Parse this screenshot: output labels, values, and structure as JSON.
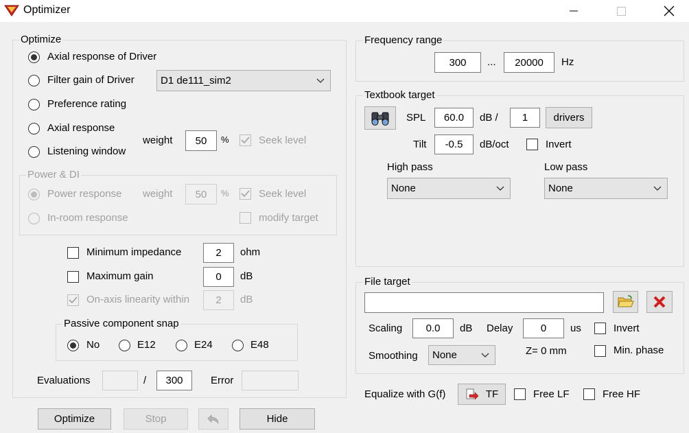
{
  "window": {
    "title": "Optimizer"
  },
  "optimize": {
    "label": "Optimize",
    "axial_driver": "Axial response of Driver",
    "filter_gain": "Filter gain of Driver",
    "driver_select": "D1 de111_sim2",
    "preference": "Preference rating",
    "axial_response": "Axial response",
    "listening_window": "Listening window",
    "weight_label": "weight",
    "weight_value": "50",
    "percent": "%",
    "seek_level": "Seek level"
  },
  "power_di": {
    "label": "Power & DI",
    "power_response": "Power response",
    "weight_label": "weight",
    "weight_value": "50",
    "percent": "%",
    "seek_level": "Seek level",
    "inroom": "In-room response",
    "modify_target": "modify target"
  },
  "constraints": {
    "min_imp": "Minimum impedance",
    "min_imp_value": "2",
    "min_imp_unit": "ohm",
    "max_gain": "Maximum gain",
    "max_gain_value": "0",
    "max_gain_unit": "dB",
    "linearity": "On-axis linearity within",
    "linearity_value": "2",
    "linearity_unit": "dB"
  },
  "snap": {
    "label": "Passive component snap",
    "no": "No",
    "e12": "E12",
    "e24": "E24",
    "e48": "E48"
  },
  "evaluations": {
    "label": "Evaluations",
    "current": "",
    "sep": "/",
    "max": "300",
    "error_label": "Error",
    "error_value": ""
  },
  "bottom": {
    "optimize": "Optimize",
    "stop": "Stop",
    "hide": "Hide"
  },
  "freq": {
    "label": "Frequency range",
    "from": "300",
    "sep": "...",
    "to": "20000",
    "unit": "Hz"
  },
  "textbook": {
    "label": "Textbook target",
    "spl_label": "SPL",
    "spl_value": "60.0",
    "db_slash": "dB /",
    "drivers_value": "1",
    "drivers_btn": "drivers",
    "tilt_label": "Tilt",
    "tilt_value": "-0.5",
    "tilt_unit": "dB/oct",
    "invert": "Invert",
    "highpass_label": "High pass",
    "highpass_value": "None",
    "lowpass_label": "Low pass",
    "lowpass_value": "None"
  },
  "file_target": {
    "label": "File target",
    "path": "",
    "scaling_label": "Scaling",
    "scaling_value": "0.0",
    "scaling_unit": "dB",
    "delay_label": "Delay",
    "delay_value": "0",
    "delay_unit": "us",
    "invert": "Invert",
    "smoothing_label": "Smoothing",
    "smoothing_value": "None",
    "z_text": "Z= 0 mm",
    "min_phase": "Min. phase"
  },
  "equalize": {
    "label": "Equalize with G(f)",
    "tf": "TF",
    "free_lf": "Free LF",
    "free_hf": "Free HF"
  }
}
